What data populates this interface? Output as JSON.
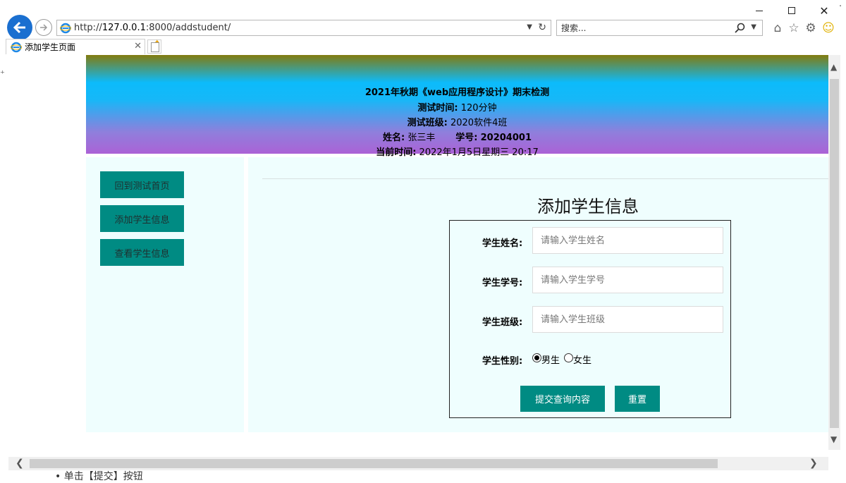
{
  "browser": {
    "url_prefix": "http://",
    "url_host": "127.0.0.1",
    "url_rest": ":8000/addstudent/",
    "search_placeholder": "搜索...",
    "tab_title": "添加学生页面"
  },
  "header": {
    "exam_title": "2021年秋期《web应用程序设计》期末检测",
    "duration_label": "测试时间:",
    "duration_value": "120分钟",
    "class_label": "测试班级:",
    "class_value": "2020软件4班",
    "name_label": "姓名:",
    "name_value": "张三丰",
    "id_label": "学号:",
    "id_value": "20204001",
    "time_label": "当前时间:",
    "time_value": "2022年1月5日星期三 20:17"
  },
  "sidebar": {
    "items": [
      {
        "label": "回到测试首页"
      },
      {
        "label": "添加学生信息"
      },
      {
        "label": "查看学生信息"
      }
    ]
  },
  "form": {
    "title": "添加学生信息",
    "name_label": "学生姓名:",
    "name_placeholder": "请输入学生姓名",
    "id_label": "学生学号:",
    "id_placeholder": "请输入学生学号",
    "class_label": "学生班级:",
    "class_placeholder": "请输入学生班级",
    "gender_label": "学生性别:",
    "gender_options": [
      "男生",
      "女生"
    ],
    "gender_selected": "男生",
    "submit_label": "提交查询内容",
    "reset_label": "重置"
  },
  "background_text": {
    "bottom": "• 单击【提交】按钮"
  },
  "colors": {
    "button": "#008b83",
    "panel": "#effefe",
    "back_button": "#1a6fd0"
  }
}
